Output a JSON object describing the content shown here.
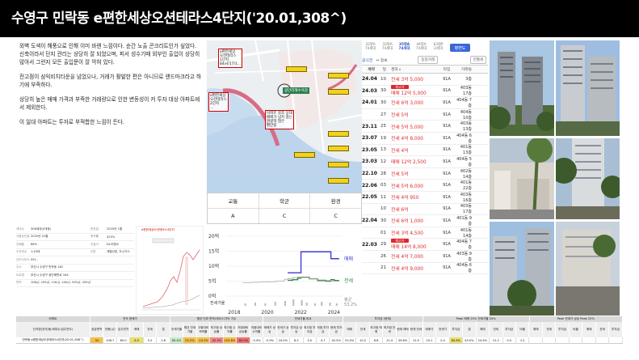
{
  "header": {
    "title": "수영구 민락동 e편한세상오션테라스4단지('20.01,308^)"
  },
  "description": [
    "외벽 도색이 해풍으로 인해 이미 바랜 느낌이다. 순간 노출 콘크리트인가 싶었다. 신축이라서 단지 관리는 상당히 잘 되었으며, 피서 성수기때 외부인 출입이 상당히 많아서 그런지 모든 출입문이 잘 막혀 있다.",
    "전고점이 삼익비치타운을 넘었으나, 거래가 활발한 편은 아니므로 랜드마크라고 하기에 부족하다.",
    "상당히 높은 매매 가격과 부족한 거래량으로 인한 변동성이 커 투자 대상 아파트에서 제외한다.",
    "이 일대 아파트는 투자로 부적합한 느낌이 든다."
  ],
  "map": {
    "labels": [
      {
        "text": "e편한세상\n오션테라스\n1단지\n84㎡/17/1..."
      },
      {
        "text": "e편한세상\n오션테라스\n2단지\n..."
      },
      {
        "text": "아파트 골조 상태\n매매가 넘지 않는\n관광객 많은\n편안함"
      },
      {
        "text": "e편한세상\n오션테라스\n4단지"
      }
    ],
    "tags": [
      "광안리해수욕장"
    ]
  },
  "scores": {
    "headers": [
      "교통",
      "학군",
      "환경"
    ],
    "values": [
      "A",
      "C",
      "C"
    ]
  },
  "apt_info": {
    "rows": [
      [
        "세대수",
        "308세대(4개동)",
        "준공일",
        "2020년 1월"
      ],
      [
        "사용승인일",
        "2020년 01월",
        "용적률",
        "425%"
      ],
      [
        "건폐율",
        "66%",
        "건설사",
        "DL이앤씨"
      ],
      [
        "주차대수",
        "1.43대",
        "난방",
        "개별난방, 도시가스"
      ],
      [
        "관리사무소",
        "051-",
        "",
        ""
      ],
      [
        "주소",
        "부산시 수영구 민락동 182",
        "",
        ""
      ],
      [
        "도로명",
        "부산시 수영구 광안해변로 344",
        "",
        ""
      ],
      [
        "면적",
        "108㎡, 109㎡, 116㎡, 140㎡, 205㎡, 209㎡",
        "",
        ""
      ]
    ]
  },
  "mini_chart": {
    "title": "e편한세상오션테라스4단지"
  },
  "price_chart": {
    "chart_data": {
      "type": "line",
      "x": [
        2018.5,
        2019,
        2019.5,
        2020,
        2020.5,
        2021,
        2021.2,
        2021.5,
        2021.8,
        2022,
        2022.5,
        2023,
        2023.5,
        2023.8,
        2024,
        2024.3
      ],
      "xticks": [
        "2018",
        "2020",
        "2022",
        "2024"
      ],
      "yticks": [
        "20억",
        "15억",
        "10억",
        "5억",
        "0억"
      ],
      "ylim": [
        0,
        20
      ],
      "series": [
        {
          "name": "매매",
          "color": "#3d3dd9",
          "values": [
            null,
            null,
            null,
            null,
            null,
            null,
            7.8,
            7.8,
            7.8,
            14.8,
            14.8,
            14.8,
            14.8,
            12.5,
            12.5,
            12.5
          ]
        },
        {
          "name": "전세",
          "color": "#2e8b3a",
          "values": [
            null,
            null,
            null,
            null,
            null,
            null,
            5.3,
            5.5,
            6.0,
            6.3,
            5.8,
            5.2,
            5.0,
            5.5,
            5.2,
            5.2
          ]
        },
        {
          "name": "평균",
          "color": "#aaaaaa",
          "values": [
            4.5,
            4.6,
            4.7,
            4.8,
            5.0,
            5.6,
            5.9,
            6.2,
            6.4,
            6.2,
            5.8,
            5.4,
            5.2,
            5.0,
            5.0,
            5.0
          ]
        }
      ],
      "labels": {
        "mae": "매매",
        "jeon": "전세",
        "avg": "평균\n53.2%",
        "vol": "전세가율"
      }
    }
  },
  "listings": {
    "type_tabs": [
      {
        "label": "32평A",
        "sub": "74세대"
      },
      {
        "label": "33평A",
        "sub": "74세대"
      },
      {
        "label": "35평A",
        "sub": "74세대",
        "active": true
      },
      {
        "label": "44평A",
        "sub": "74세대"
      },
      {
        "label": "63평P",
        "sub": "2세대"
      }
    ],
    "tab_button": "평면도",
    "controls": {
      "left": "공식전",
      "sort": "↔ 정보",
      "btn1": "동일거래",
      "btn2": "전월세"
    },
    "headers": [
      "계약",
      "일",
      "경과↓",
      "타입",
      "거래동"
    ],
    "rows": [
      {
        "ym": "24.04",
        "d": "10",
        "text": "전세 3억 5,000",
        "badge": "",
        "a": "91A",
        "f": "3층"
      },
      {
        "ym": "24.03",
        "d": "30",
        "text": "매매 12억 5,000",
        "badge": "최고가",
        "a": "91A",
        "f": "403동 17층"
      },
      {
        "ym": "24.01",
        "d": "30",
        "text": "전세 6억 3,000",
        "badge": "",
        "a": "91A",
        "f": "404동 7층"
      },
      {
        "ym": "",
        "d": "27",
        "text": "전세 5억",
        "badge": "",
        "a": "91A",
        "f": "404동 10층"
      },
      {
        "ym": "23.11",
        "d": "25",
        "text": "전세 5억 5,000",
        "badge": "",
        "a": "91A",
        "f": "403동 13층"
      },
      {
        "ym": "23.07",
        "d": "19",
        "text": "전세 4억 8,000",
        "badge": "",
        "a": "91A",
        "f": "404동 6층"
      },
      {
        "ym": "23.05",
        "d": "13",
        "text": "전세 4억",
        "badge": "",
        "a": "91A",
        "f": "401동 13층"
      },
      {
        "ym": "23.03",
        "d": "12",
        "text": "매매 12억 2,500",
        "badge": "",
        "a": "91A",
        "f": "404동 5층"
      },
      {
        "ym": "22.10",
        "d": "28",
        "text": "전세 5억",
        "badge": "",
        "a": "91A",
        "f": "402동 14층"
      },
      {
        "ym": "22.06",
        "d": "03",
        "text": "전세 5억 6,000",
        "badge": "",
        "a": "91A",
        "f": "401동 22층"
      },
      {
        "ym": "22.05",
        "d": "11",
        "text": "전세 4억 950",
        "badge": "",
        "a": "91A",
        "f": "403동 16층"
      },
      {
        "ym": "",
        "d": "10",
        "text": "전세 6억",
        "badge": "",
        "a": "91A",
        "f": "403동 17층"
      },
      {
        "ym": "22.04",
        "d": "30",
        "text": "전세 6억 1,000",
        "badge": "",
        "a": "91A",
        "f": "401동 9층"
      },
      {
        "ym": "",
        "d": "01",
        "text": "전세 3억 4,500",
        "badge": "",
        "a": "91A",
        "f": "401동 14층"
      },
      {
        "ym": "22.03",
        "d": "29",
        "text": "매매 14억 8,000",
        "badge": "최고가",
        "a": "91A",
        "f": "404동 7층"
      },
      {
        "ym": "",
        "d": "26",
        "text": "전세 4억 7,000",
        "badge": "",
        "a": "91A",
        "f": "403동 9층"
      },
      {
        "ym": "",
        "d": "21",
        "text": "전세 4억 9,000",
        "badge": "",
        "a": "91A",
        "f": "404동 6층"
      }
    ]
  },
  "bottom_table": {
    "group_headers": [
      "아파트",
      "전국 현재가",
      "평균 단위 면적/서비스/기타 가수",
      "전세가율 비교",
      "투자금 (현재)",
      "Peak 매매 25% 전세가율 25%",
      "Peak 전세가 상승 Peak 25%"
    ],
    "sub_headers": [
      "단지명(전국/동/세대수/입주연도)",
      "공급면적",
      "전용(㎡)",
      "입주연차",
      "매매",
      "전세",
      "갭",
      "전세가율",
      "평균 전세가율",
      "고점대비 하락률",
      "최고점 상승률",
      "최고점 수익률",
      "저점대비 상승률",
      "저점대비 수익률",
      "매매가 상승",
      "전세가 상승",
      "투자금 상승",
      "최고점 투자금",
      "저점 투자금",
      "현재 투자금",
      "매매",
      "전세",
      "최고점 매매",
      "최고점 전세",
      "현재 매매",
      "현재 전세",
      "매매가",
      "전세가",
      "투자금",
      "갭",
      "매매",
      "전세",
      "투자금",
      "비율",
      "매매",
      "전세",
      "투자금",
      "비율",
      "매매",
      "전세",
      "투자금"
    ],
    "row": [
      "민락동 e편한세상오션테라스4단지(20.01,308^)",
      "34",
      "108.7",
      "85.0",
      "8.0",
      "5.2",
      "2.8",
      "65.4%",
      "52.2%",
      "-14.1%",
      "-30.9%",
      "103.8%",
      "-80.0%",
      "-3.4%",
      "-5.9%",
      "24.0%",
      "8.2",
      "3.5",
      "4.7",
      "42.5%",
      "22.0%",
      "10.2",
      "6.8",
      "11.4",
      "39.6%",
      "12.5",
      "10.1",
      "2.4",
      "80.8%",
      "43.0%",
      "24.4%",
      "12.2",
      "0.0",
      "1.2",
      "",
      "",
      "",
      "",
      "",
      "",
      ""
    ],
    "row_colors": [
      "#fff",
      "#f6c046",
      "#fff",
      "#fff",
      "#e8e16b",
      "#fff",
      "#fff",
      "#c8ecc8",
      "#f6c046",
      "#f6c046",
      "#f58a8a",
      "#f6c046",
      "#f27272",
      "#fff",
      "#fff",
      "#fff",
      "#fff",
      "#fff",
      "#fff",
      "#fff",
      "#fff",
      "#fff",
      "#fff",
      "#fff",
      "#fff",
      "#fff",
      "#fff",
      "#fff",
      "#e8e16b",
      "#fff",
      "#fff",
      "#fff",
      "#fff",
      "#fff",
      "#fff",
      "#fff",
      "#fff",
      "#fff",
      "#fff",
      "#fff",
      "#fff"
    ]
  }
}
